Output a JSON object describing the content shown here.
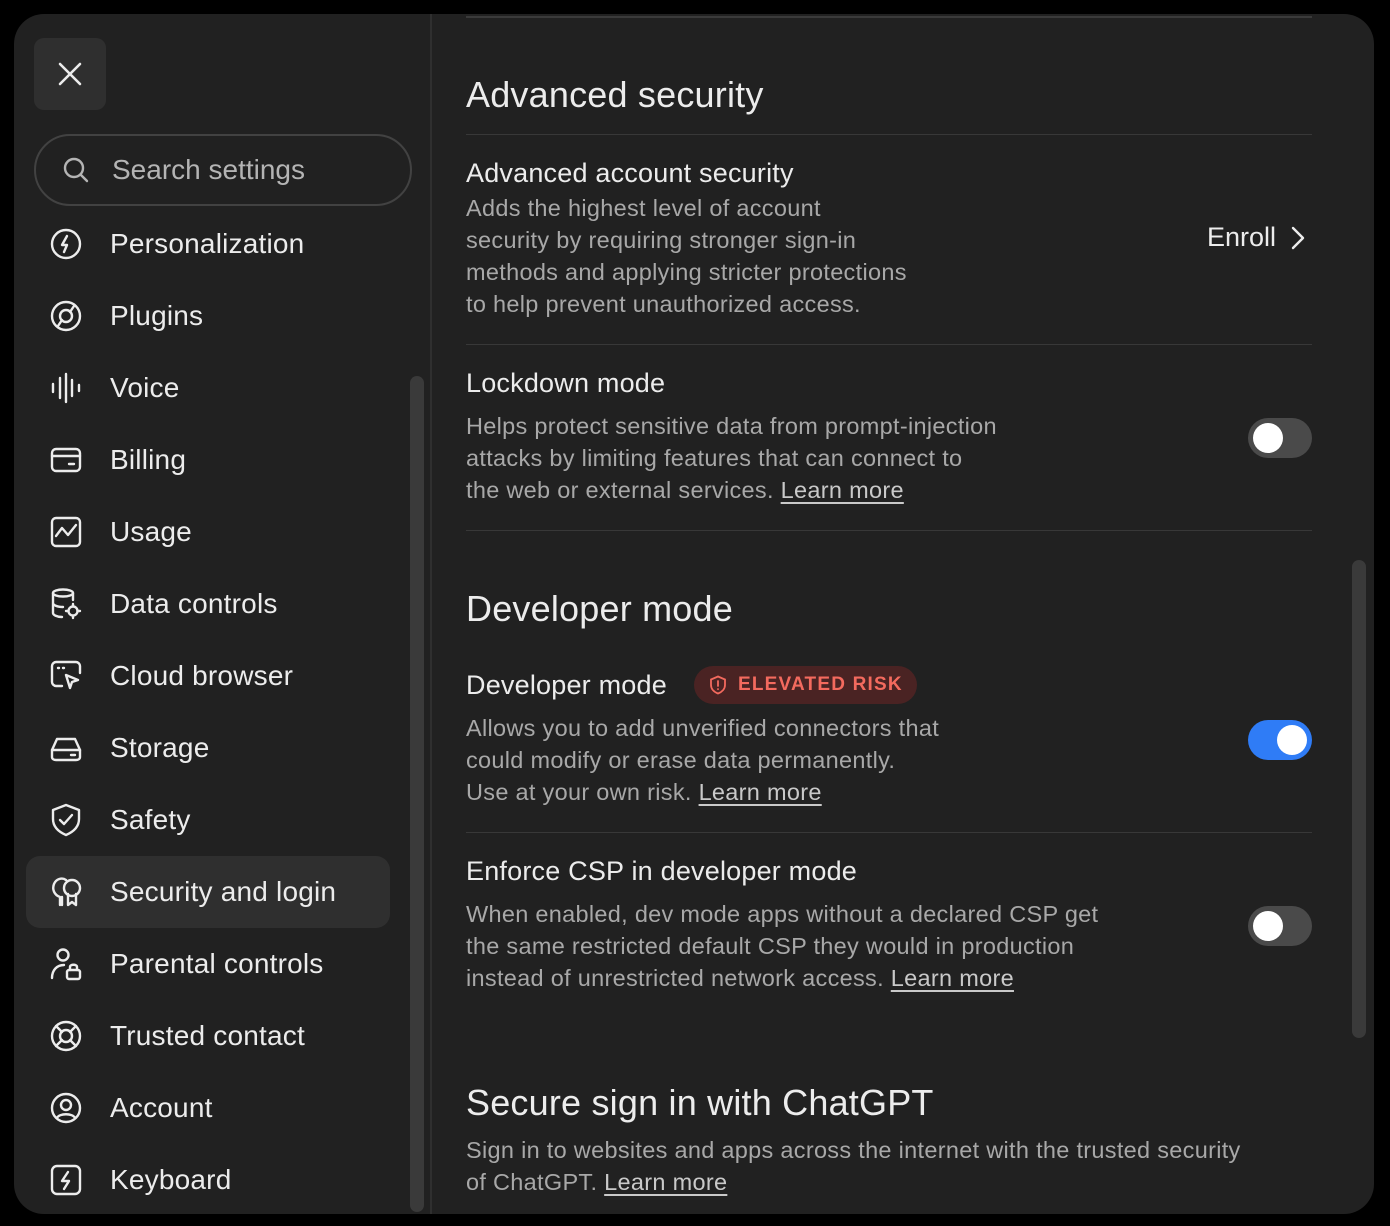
{
  "sidebar": {
    "search_placeholder": "Search settings",
    "items": [
      {
        "label": "Personalization",
        "icon": "personalization-icon"
      },
      {
        "label": "Plugins",
        "icon": "plugins-icon"
      },
      {
        "label": "Voice",
        "icon": "voice-icon"
      },
      {
        "label": "Billing",
        "icon": "billing-icon"
      },
      {
        "label": "Usage",
        "icon": "usage-icon"
      },
      {
        "label": "Data controls",
        "icon": "data-controls-icon"
      },
      {
        "label": "Cloud browser",
        "icon": "cloud-browser-icon"
      },
      {
        "label": "Storage",
        "icon": "storage-icon"
      },
      {
        "label": "Safety",
        "icon": "shield-check-icon"
      },
      {
        "label": "Security and login",
        "icon": "security-login-icon",
        "active": true
      },
      {
        "label": "Parental controls",
        "icon": "parental-controls-icon"
      },
      {
        "label": "Trusted contact",
        "icon": "lifebuoy-icon"
      },
      {
        "label": "Account",
        "icon": "account-icon"
      },
      {
        "label": "Keyboard",
        "icon": "keyboard-icon"
      }
    ]
  },
  "main": {
    "advanced": {
      "title": "Advanced security",
      "account_security": {
        "title": "Advanced account security",
        "desc_lines": [
          "Adds the highest level of account",
          "security by requiring stronger sign-in",
          "methods and applying stricter protections",
          "to help prevent unauthorized access."
        ],
        "action": "Enroll"
      },
      "lockdown": {
        "title": "Lockdown mode",
        "desc_lines": [
          "Helps protect sensitive data from prompt-injection",
          "attacks by limiting features that can connect to",
          "the web or external services."
        ],
        "link": "Learn more",
        "enabled": false
      }
    },
    "developer": {
      "title": "Developer mode",
      "mode": {
        "title": "Developer mode",
        "badge": "ELEVATED RISK",
        "desc_lines": [
          "Allows you to add unverified connectors that",
          "could modify or erase data permanently.",
          "Use at your own risk."
        ],
        "link": "Learn more",
        "enabled": true
      },
      "csp": {
        "title": "Enforce CSP in developer mode",
        "desc_lines": [
          "When enabled, dev mode apps without a declared CSP get",
          "the same restricted default CSP they would in production",
          "instead of unrestricted network access."
        ],
        "link": "Learn more",
        "enabled": false
      }
    },
    "secure_signin": {
      "title": "Secure sign in with ChatGPT",
      "desc_lines": [
        "Sign in to websites and apps across the internet with the trusted security",
        "of ChatGPT."
      ],
      "link": "Learn more"
    }
  },
  "colors": {
    "background": "#212121",
    "toggle_on": "#2f7cf6",
    "risk": "#f36a5e"
  }
}
